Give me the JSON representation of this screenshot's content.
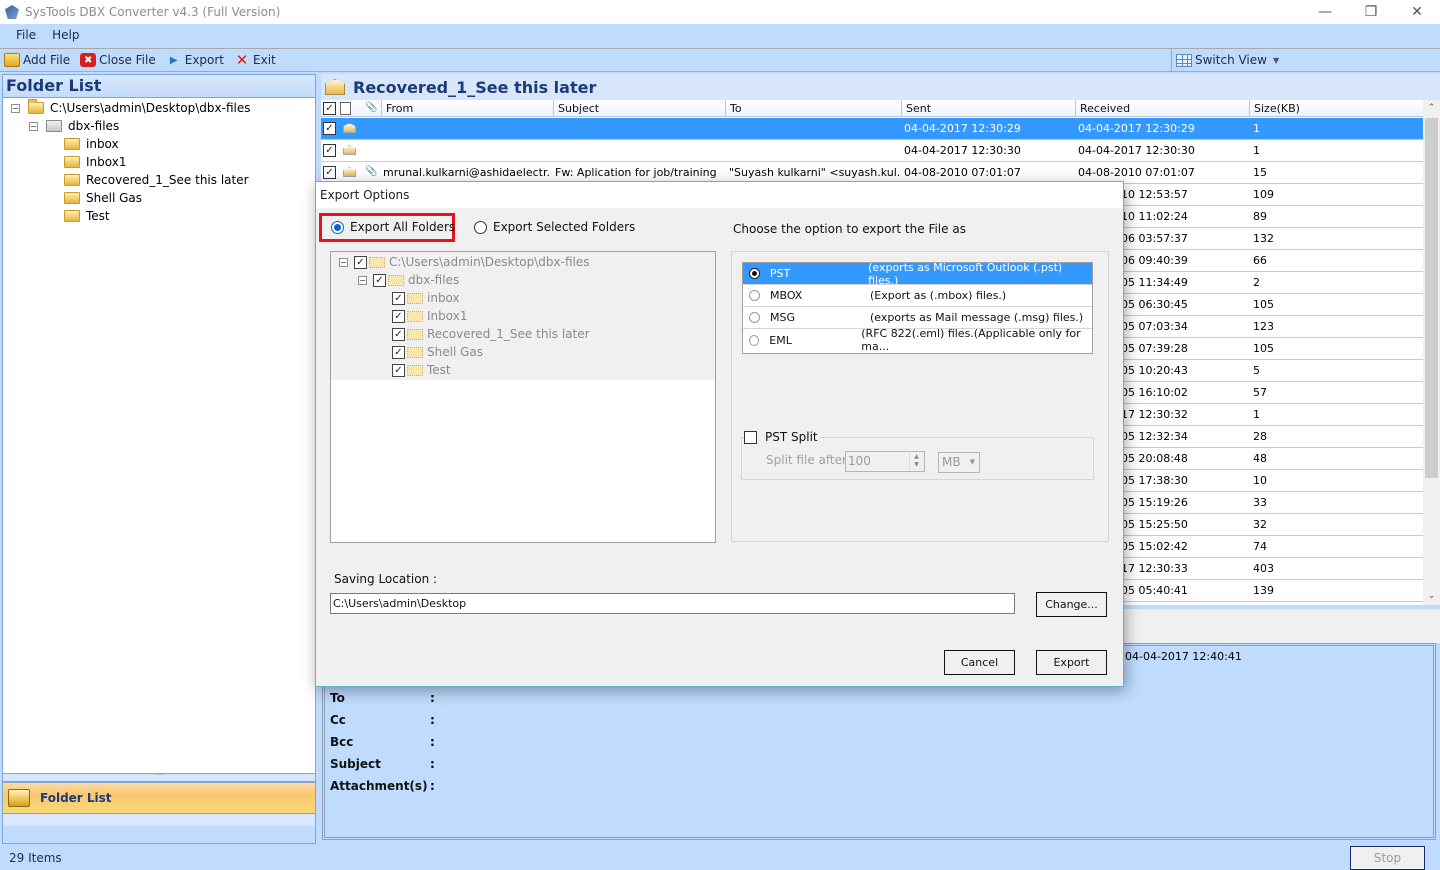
{
  "window": {
    "title": "SysTools DBX Converter v4.3 (Full Version)",
    "controls": [
      "minimize",
      "restore",
      "close"
    ]
  },
  "menu": [
    "File",
    "Help"
  ],
  "toolbar": {
    "add_file": "Add File",
    "close_file": "Close File",
    "export": "Export",
    "exit": "Exit",
    "switch_view": "Switch View"
  },
  "left_panel": {
    "header": "Folder List",
    "tree": [
      {
        "label": "C:\\Users\\admin\\Desktop\\dbx-files",
        "level": 0,
        "expanded": true
      },
      {
        "label": "dbx-files",
        "level": 1,
        "expanded": true
      },
      {
        "label": "inbox",
        "level": 2
      },
      {
        "label": "Inbox1",
        "level": 2
      },
      {
        "label": "Recovered_1_See this later",
        "level": 2
      },
      {
        "label": "Shell Gas",
        "level": 2
      },
      {
        "label": "Test",
        "level": 2
      }
    ],
    "nav_button": "Folder List"
  },
  "mail_list": {
    "folder_title": "Recovered_1_See this later",
    "columns": [
      "From",
      "Subject",
      "To",
      "Sent",
      "Received",
      "Size(KB)"
    ],
    "rows": [
      {
        "from": "",
        "subject": "",
        "to": "",
        "sent": "04-04-2017 12:30:29",
        "received": "04-04-2017 12:30:29",
        "size": "1",
        "attach": false,
        "selected": true
      },
      {
        "from": "",
        "subject": "",
        "to": "",
        "sent": "04-04-2017 12:30:30",
        "received": "04-04-2017 12:30:30",
        "size": "1",
        "attach": false
      },
      {
        "from": "mrunal.kulkarni@ashidaelectr...",
        "subject": "Fw: Aplication for job/training",
        "to": "\"Suyash kulkarni\" <suyash.kul...",
        "sent": "04-08-2010 07:01:07",
        "received": "04-08-2010 07:01:07",
        "size": "15",
        "attach": true
      },
      {
        "received": "10 12:53:57",
        "size": "109"
      },
      {
        "received": "10 11:02:24",
        "size": "89"
      },
      {
        "received": "06 03:57:37",
        "size": "132"
      },
      {
        "received": "06 09:40:39",
        "size": "66"
      },
      {
        "received": "05 11:34:49",
        "size": "2"
      },
      {
        "received": "05 06:30:45",
        "size": "105"
      },
      {
        "received": "05 07:03:34",
        "size": "123"
      },
      {
        "received": "05 07:39:28",
        "size": "105"
      },
      {
        "received": "05 10:20:43",
        "size": "5"
      },
      {
        "received": "05 16:10:02",
        "size": "57"
      },
      {
        "received": "17 12:30:32",
        "size": "1"
      },
      {
        "received": "05 12:32:34",
        "size": "28"
      },
      {
        "received": "05 20:08:48",
        "size": "48"
      },
      {
        "received": "05 17:38:30",
        "size": "10"
      },
      {
        "received": "05 15:19:26",
        "size": "33"
      },
      {
        "received": "05 15:25:50",
        "size": "32"
      },
      {
        "received": "05 15:02:42",
        "size": "74"
      },
      {
        "received": "17 12:30:33",
        "size": "403"
      },
      {
        "received": "05 05:40:41",
        "size": "139"
      }
    ]
  },
  "preview": {
    "date_value": "04-04-2017 12:40:41",
    "fields": [
      "To",
      "Cc",
      "Bcc",
      "Subject",
      "Attachment(s)"
    ],
    "separator": ":"
  },
  "status": {
    "items": "29 Items",
    "stop": "Stop"
  },
  "dialog": {
    "title": "Export Options",
    "export_all": "Export All Folders",
    "export_selected": "Export Selected Folders",
    "export_mode": "all",
    "folders": [
      {
        "label": "C:\\Users\\admin\\Desktop\\dbx-files",
        "level": 0,
        "checked": true
      },
      {
        "label": "dbx-files",
        "level": 1,
        "checked": true
      },
      {
        "label": "inbox",
        "level": 2,
        "checked": true
      },
      {
        "label": "Inbox1",
        "level": 2,
        "checked": true
      },
      {
        "label": "Recovered_1_See this later",
        "level": 2,
        "checked": true
      },
      {
        "label": "Shell Gas",
        "level": 2,
        "checked": true
      },
      {
        "label": "Test",
        "level": 2,
        "checked": true
      }
    ],
    "choose_label": "Choose the option to export the File as",
    "formats": [
      {
        "name": "PST",
        "desc": "(exports as Microsoft Outlook (.pst) files.)",
        "selected": true
      },
      {
        "name": "MBOX",
        "desc": "(Export as (.mbox) files.)"
      },
      {
        "name": "MSG",
        "desc": "(exports as Mail message (.msg) files.)"
      },
      {
        "name": "EML",
        "desc": "(RFC 822(.eml) files.(Applicable only for ma..."
      }
    ],
    "pst_split": {
      "label": "PST Split",
      "checked": false,
      "split_after_label": "Split file after",
      "value": "100",
      "unit": "MB"
    },
    "saving_location_label": "Saving Location :",
    "saving_location": "C:\\Users\\admin\\Desktop",
    "change_button": "Change...",
    "cancel_button": "Cancel",
    "export_button": "Export"
  },
  "colors": {
    "accent_blue": "#3399ff",
    "panel_blue": "#bfdbfe",
    "highlight_red": "#e3141f",
    "header_text": "#1b3a78"
  }
}
